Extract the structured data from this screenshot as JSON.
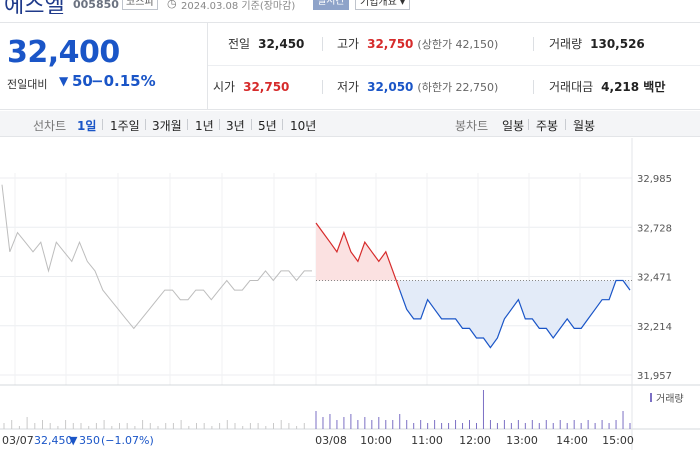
{
  "header": {
    "name": "에스엘",
    "code": "005850",
    "market_badge": "코스피",
    "date": "2024.03.08 기준(장마감)",
    "live_badge": "실시간",
    "company_info_button": "기업개요 ▾",
    "clock_icon": "clock-icon"
  },
  "quote": {
    "price": "32,400",
    "change_label": "전일대비",
    "change_arrow": "▼",
    "change_value": "50",
    "change_pct": "−0.15%",
    "prev_close_label": "전일",
    "prev_close": "32,450",
    "high_label": "고가",
    "high": "32,750",
    "upper_limit": "(상한가 42,150)",
    "volume_label": "거래량",
    "volume": "130,526",
    "open_label": "시가",
    "open": "32,750",
    "low_label": "저가",
    "low": "32,050",
    "lower_limit": "(하한가 22,750)",
    "amount_label": "거래대금",
    "amount": "4,218 백만"
  },
  "toolbar": {
    "line_chart_label": "선차트",
    "periods": [
      "1일",
      "1주일",
      "3개월",
      "1년",
      "3년",
      "5년",
      "10년"
    ],
    "selected_period": "1일",
    "candle_label": "봉차트",
    "candles": [
      "일봉",
      "주봉",
      "월봉"
    ]
  },
  "colors": {
    "up": "#d62b2b",
    "down": "#1a55c7",
    "up_fill": "#fbe1e1",
    "down_fill": "#e3ebf8",
    "prev_line": "#bdbdbd"
  },
  "chart_data": {
    "type": "line",
    "y_ticks": [
      "32,985",
      "32,728",
      "32,471",
      "32,214",
      "31,957"
    ],
    "ylim": [
      31957,
      32985
    ],
    "reference_price": 32450,
    "x_labels": [
      "03/08",
      "10:00",
      "11:00",
      "12:00",
      "13:00",
      "14:00",
      "15:00"
    ],
    "prev_day_label": "03/07",
    "prev_day_summary": {
      "price": "32,450",
      "arrow": "▼",
      "change": "350",
      "pct": "(−1.07%)"
    },
    "volume_legend": "거래량",
    "prev_day_series": {
      "name": "03/07",
      "values": [
        32950,
        32600,
        32700,
        32650,
        32600,
        32650,
        32500,
        32650,
        32600,
        32550,
        32650,
        32550,
        32500,
        32400,
        32350,
        32300,
        32250,
        32200,
        32250,
        32300,
        32350,
        32400,
        32400,
        32350,
        32350,
        32400,
        32400,
        32350,
        32400,
        32450,
        32400,
        32400,
        32450,
        32450,
        32500,
        32450,
        32500,
        32500,
        32450,
        32500,
        32500
      ]
    },
    "series": [
      {
        "name": "03/08",
        "times": [
          "09:00",
          "09:05",
          "09:10",
          "09:15",
          "09:20",
          "09:25",
          "09:30",
          "09:35",
          "09:40",
          "09:45",
          "09:50",
          "09:55",
          "10:00",
          "10:10",
          "10:20",
          "10:30",
          "10:40",
          "10:50",
          "11:00",
          "11:10",
          "11:20",
          "11:30",
          "11:40",
          "11:50",
          "12:00",
          "12:10",
          "12:20",
          "12:30",
          "12:40",
          "12:50",
          "13:00",
          "13:10",
          "13:20",
          "13:30",
          "13:40",
          "13:50",
          "14:00",
          "14:10",
          "14:20",
          "14:30",
          "14:40",
          "14:50",
          "15:00",
          "15:10",
          "15:20",
          "15:30"
        ],
        "values": [
          32750,
          32700,
          32650,
          32600,
          32700,
          32600,
          32550,
          32650,
          32600,
          32550,
          32600,
          32500,
          32400,
          32300,
          32250,
          32250,
          32350,
          32300,
          32250,
          32250,
          32250,
          32200,
          32200,
          32150,
          32150,
          32100,
          32150,
          32250,
          32300,
          32350,
          32250,
          32250,
          32200,
          32200,
          32150,
          32200,
          32250,
          32200,
          32200,
          32250,
          32300,
          32350,
          32350,
          32450,
          32450,
          32400
        ]
      }
    ],
    "volume_prev": [
      2,
      3,
      1,
      4,
      2,
      3,
      2,
      1,
      3,
      2,
      2,
      1,
      2,
      3,
      1,
      2,
      2,
      1,
      3,
      2,
      1,
      2,
      2,
      3,
      1,
      2,
      2,
      1,
      2,
      3,
      2,
      1,
      2,
      2,
      1,
      2,
      3,
      2,
      1,
      2
    ],
    "volume_today": [
      6,
      4,
      5,
      3,
      4,
      5,
      3,
      4,
      3,
      4,
      3,
      3,
      5,
      3,
      2,
      3,
      2,
      3,
      2,
      2,
      3,
      2,
      3,
      2,
      13,
      3,
      2,
      3,
      2,
      3,
      2,
      3,
      2,
      3,
      2,
      3,
      2,
      3,
      2,
      3,
      2,
      3,
      2,
      3,
      6,
      2
    ]
  }
}
